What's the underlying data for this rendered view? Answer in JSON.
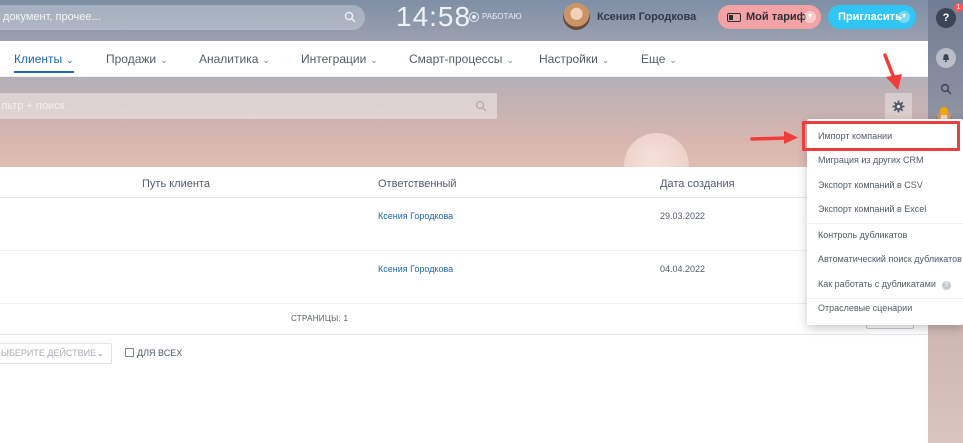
{
  "header": {
    "search_placeholder": "документ, прочее...",
    "clock": "14:58",
    "work_status": "РАБОТАЮ",
    "user_name": "Ксения Городкова",
    "tariff_label": "Мой тариф",
    "invite_label": "Пригласить"
  },
  "right_panel": {
    "help_label": "?",
    "notification_count": "1"
  },
  "nav": {
    "items": [
      {
        "label": "Клиенты",
        "active": true
      },
      {
        "label": "Продажи"
      },
      {
        "label": "Аналитика"
      },
      {
        "label": "Интеграции"
      },
      {
        "label": "Смарт-процессы"
      },
      {
        "label": "Настройки"
      },
      {
        "label": "Еще"
      }
    ]
  },
  "filter": {
    "placeholder": "льтр + поиск"
  },
  "table": {
    "columns": [
      "Путь клиента",
      "Ответственный",
      "Дата создания"
    ],
    "rows": [
      {
        "responsible": "Ксения Городкова",
        "created": "29.03.2022"
      },
      {
        "responsible": "Ксения Городкова",
        "created": "04.04.2022"
      }
    ],
    "pages_label": "СТРАНИЦЫ: 1"
  },
  "footer": {
    "action_placeholder": "ЫБЕРИТЕ ДЕЙСТВИЕ",
    "for_all_label": "ДЛЯ ВСЕХ"
  },
  "menu": {
    "items": [
      "Импорт компании",
      "Миграция из других CRM",
      "Экспорт компаний в CSV",
      "Экспорт компаний в Excel",
      "Контроль дубликатов",
      "Автоматический поиск дубликатов",
      "Как работать с дубликатами",
      "Отраслевые сценарии"
    ]
  },
  "colors": {
    "accent": "#2067b0",
    "invite": "#2fc6f6",
    "tariff": "#f3a3a5",
    "annotation": "#ee3d3a"
  }
}
